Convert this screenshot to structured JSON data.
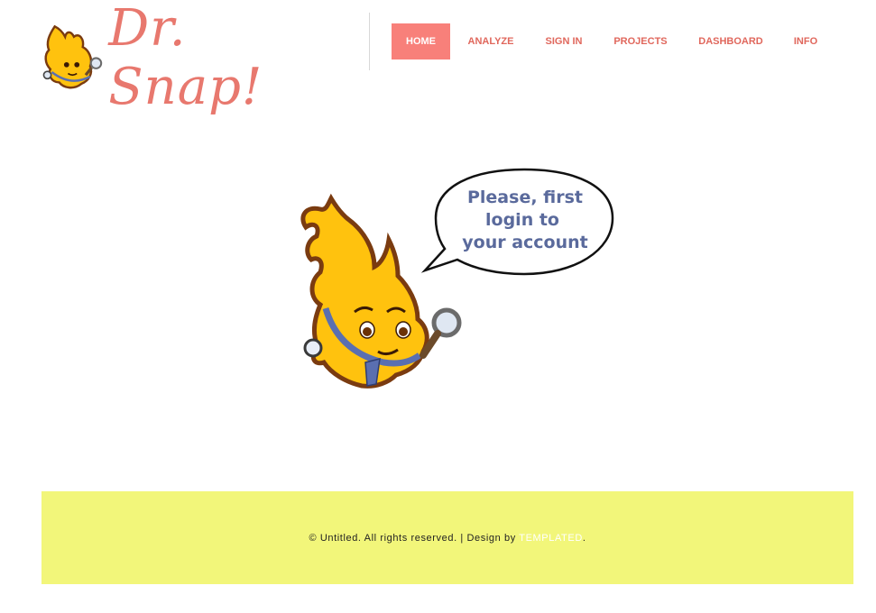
{
  "brand": {
    "logo_text": "Dr. Snap!",
    "color": "#e8786e"
  },
  "nav": {
    "items": [
      {
        "label": "HOME",
        "active": true
      },
      {
        "label": "ANALYZE",
        "active": false
      },
      {
        "label": "SIGN IN",
        "active": false
      },
      {
        "label": "PROJECTS",
        "active": false
      },
      {
        "label": "DASHBOARD",
        "active": false
      },
      {
        "label": "INFO",
        "active": false
      }
    ],
    "active_color": "#f8807a",
    "link_color": "#e0675c"
  },
  "hero": {
    "bubble_lines": [
      "Please, first",
      "login to",
      "your account"
    ],
    "mascot_icon": "snap-mascot-icon"
  },
  "footer": {
    "text": "© Untitled. All rights reserved. | Design by ",
    "link_label": "TEMPLATED",
    "suffix": ".",
    "background": "#f2f67a"
  }
}
